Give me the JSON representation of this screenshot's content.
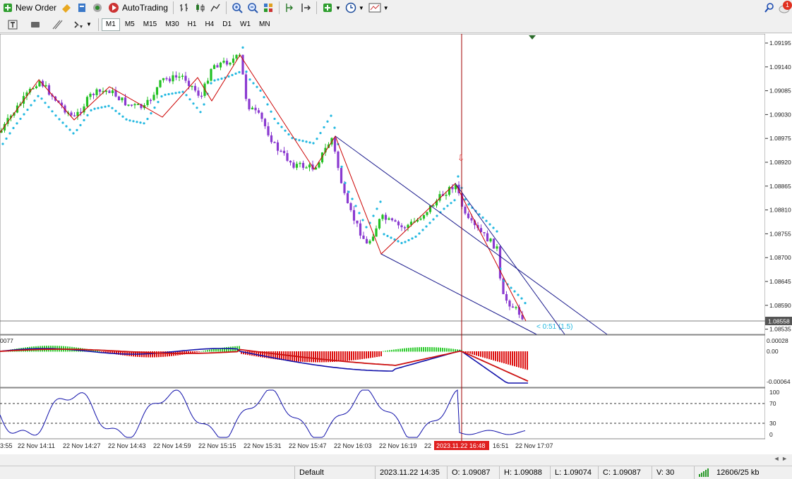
{
  "toolbar": {
    "new_order": "New Order",
    "auto_trading": "AutoTrading",
    "notification_count": "1"
  },
  "timeframes": [
    "M1",
    "M5",
    "M15",
    "M30",
    "H1",
    "H4",
    "D1",
    "W1",
    "MN"
  ],
  "active_timeframe": "M1",
  "price_axis": [
    "1.09195",
    "1.09140",
    "1.09085",
    "1.09030",
    "1.08975",
    "1.08920",
    "1.08865",
    "1.08810",
    "1.08755",
    "1.08700",
    "1.08645",
    "1.08590",
    "1.08535"
  ],
  "current_price": "1.08558",
  "countdown_label": "< 0:51 (1.5)",
  "macd": {
    "level_label": "0077",
    "axis": [
      "0.00028",
      "0.00",
      "-0.00064"
    ]
  },
  "stoch": {
    "axis": [
      "100",
      "70",
      "30",
      "0"
    ]
  },
  "time_axis": [
    "3:55",
    "22 Nov 14:11",
    "22 Nov 14:27",
    "22 Nov 14:43",
    "22 Nov 14:59",
    "22 Nov 15:15",
    "22 Nov 15:31",
    "22 Nov 15:47",
    "22 Nov 16:03",
    "22 Nov 16:19",
    "22",
    "16:51",
    "22 Nov 17:07"
  ],
  "crosshair_time": "2023.11.22 16:48",
  "status": {
    "profile": "Default",
    "datetime": "2023.11.22 14:35",
    "open": "O: 1.09087",
    "high": "H: 1.09088",
    "low": "L: 1.09074",
    "close": "C: 1.09087",
    "volume": "V: 30",
    "traffic": "12606/25 kb"
  },
  "colors": {
    "bull": "#22c022",
    "bear": "#8a3ad0",
    "sar": "#22b8e0",
    "zigzag": "#cc0000",
    "channel": "#1a1a8c",
    "crosshair": "#a00000",
    "macd_pos": "#33cc33",
    "macd_neg": "#dd1111",
    "macd_line": "#1111aa",
    "signal_line": "#cc1111"
  }
}
